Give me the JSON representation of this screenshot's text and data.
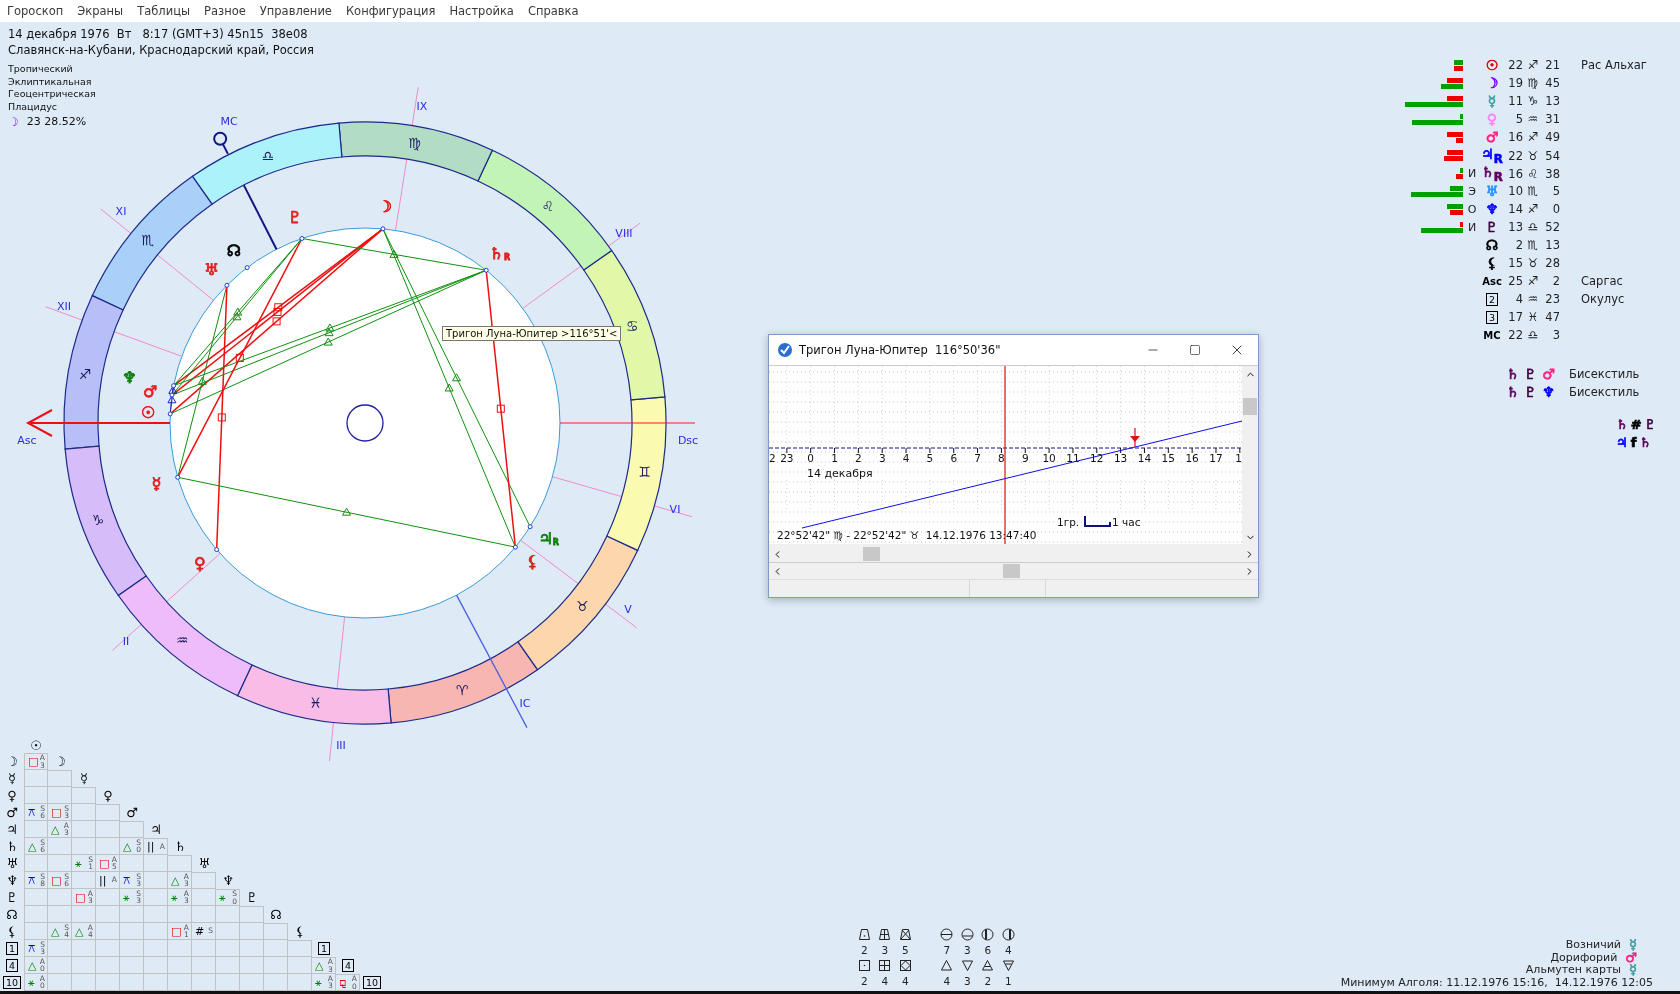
{
  "menu": [
    "Гороскоп",
    "Экраны",
    "Таблицы",
    "Разное",
    "Управление",
    "Конфигурация",
    "Настройка",
    "Справка"
  ],
  "header": {
    "date_line": "14 декабря 1976  Вт   8:17 (GMT+3) 45n15  38e08",
    "place": "Славянск-на-Кубани, Краснодарский край, Россия",
    "settings": [
      "Тропический",
      "Эклиптикальная",
      "Геоцентрическая",
      "Плацидус"
    ],
    "moon_glyph": "☽",
    "moon_phase": "23 28.52%"
  },
  "wheel": {
    "signs": [
      "♈",
      "♉",
      "♊",
      "♋",
      "♌",
      "♍",
      "♎",
      "♏",
      "♐",
      "♑",
      "♒",
      "♓"
    ],
    "houses": [
      "Asc",
      "II",
      "III",
      "IC",
      "V",
      "VI",
      "Dsc",
      "VIII",
      "IX",
      "MC",
      "XI",
      "XII"
    ],
    "planets": [
      {
        "glyph": "☉",
        "color": "#e02020"
      },
      {
        "glyph": "☽",
        "color": "#e02020"
      },
      {
        "glyph": "☿",
        "color": "#e02020"
      },
      {
        "glyph": "♀",
        "color": "#e02020"
      },
      {
        "glyph": "♂",
        "color": "#e02020"
      },
      {
        "glyph": "♃",
        "suffix": "R",
        "color": "#108010"
      },
      {
        "glyph": "♄",
        "suffix": "R",
        "color": "#e02020"
      },
      {
        "glyph": "♅",
        "color": "#e02020"
      },
      {
        "glyph": "♆",
        "color": "#108010"
      },
      {
        "glyph": "♇",
        "color": "#e02020"
      },
      {
        "glyph": "☊",
        "color": "#000000"
      },
      {
        "glyph": "⚸",
        "color": "#e02020"
      }
    ],
    "tooltip": "Тригон Луна-Юпитер >116°51'<"
  },
  "positions": [
    {
      "kind": "planet",
      "bars": [
        {
          "kind": "plus"
        },
        {
          "kind": "minus"
        }
      ],
      "glyph": "☉",
      "color": "#e00000",
      "degree": "22",
      "sign": "♐",
      "minute": "21",
      "star": "Рас Альхаг"
    },
    {
      "kind": "planet",
      "bars": [
        {
          "kind": "minus"
        },
        {
          "kind": "plus"
        }
      ],
      "glyph": "☽",
      "color": "#8000ff",
      "degree": "19",
      "sign": "♍",
      "minute": "45"
    },
    {
      "kind": "planet",
      "bars": [
        {
          "kind": "minus"
        },
        {
          "kind": "plus"
        }
      ],
      "glyph": "☿",
      "color": "#40a0a0",
      "degree": "11",
      "sign": "♑",
      "minute": "13"
    },
    {
      "kind": "planet",
      "bars": [
        {
          "kind": "plus"
        },
        {
          "kind": "plus"
        }
      ],
      "glyph": "♀",
      "color": "#ff80ff",
      "degree": "5",
      "sign": "♒",
      "minute": "31"
    },
    {
      "kind": "planet",
      "bars": [
        {
          "kind": "minus"
        },
        {
          "kind": "minus"
        }
      ],
      "glyph": "♂",
      "color": "#ff2080",
      "degree": "16",
      "sign": "♐",
      "minute": "49"
    },
    {
      "kind": "planet",
      "bars": [
        {
          "kind": "minus"
        },
        {
          "kind": "minus"
        }
      ],
      "glyph": "♃",
      "suffix": "R",
      "color": "#0000ff",
      "degree": "22",
      "sign": "♉",
      "minute": "54"
    },
    {
      "kind": "planet",
      "bars": [
        {
          "kind": "plus"
        },
        {
          "kind": "minus"
        }
      ],
      "marker": "И",
      "glyph": "♄",
      "suffix": "R",
      "color": "#600060",
      "degree": "16",
      "sign": "♌",
      "minute": "38"
    },
    {
      "kind": "planet",
      "bars": [
        {
          "kind": "plus"
        },
        {
          "kind": "plus"
        }
      ],
      "marker": "Э",
      "glyph": "♅",
      "color": "#2090ff",
      "degree": "10",
      "sign": "♏",
      "minute": "5"
    },
    {
      "kind": "planet",
      "bars": [
        {
          "kind": "plus"
        },
        {
          "kind": "minus"
        }
      ],
      "marker": "О",
      "glyph": "♆",
      "color": "#0000ff",
      "degree": "14",
      "sign": "♐",
      "minute": "0"
    },
    {
      "kind": "planet",
      "bars": [
        {
          "kind": "minus"
        },
        {
          "kind": "plus"
        }
      ],
      "marker": "И",
      "glyph": "♇",
      "color": "#400040",
      "degree": "13",
      "sign": "♎",
      "minute": "52"
    },
    {
      "kind": "planet",
      "glyph": "☊",
      "color": "#000000",
      "degree": "2",
      "sign": "♏",
      "minute": "13"
    },
    {
      "kind": "planet",
      "glyph": "⚸",
      "color": "#000000",
      "degree": "15",
      "sign": "♉",
      "minute": "28"
    },
    {
      "kind": "point",
      "glyph": "Asc",
      "color": "#000000",
      "degree": "25",
      "sign": "♐",
      "minute": "2",
      "star": "Саргас"
    },
    {
      "kind": "house",
      "glyph": "2",
      "color": "#000000",
      "degree": "4",
      "sign": "♒",
      "minute": "23",
      "star": "Окулус"
    },
    {
      "kind": "house",
      "glyph": "3",
      "color": "#000000",
      "degree": "17",
      "sign": "♓",
      "minute": "47"
    },
    {
      "kind": "point",
      "glyph": "MC",
      "color": "#000000",
      "degree": "22",
      "sign": "♎",
      "minute": "3"
    }
  ],
  "configurations": [
    {
      "glyphs": [
        {
          "text": "♄",
          "color": "#600060"
        },
        {
          "text": "♇",
          "color": "#400040"
        },
        {
          "text": "♂",
          "color": "#ff2080"
        }
      ],
      "label": "Бисекстиль"
    },
    {
      "glyphs": [
        {
          "text": "♄",
          "color": "#600060"
        },
        {
          "text": "♇",
          "color": "#400040"
        },
        {
          "text": "♆",
          "color": "#0000ff"
        }
      ],
      "label": "Бисекстиль"
    }
  ],
  "relations": [
    [
      {
        "text": "♄",
        "color": "#600060"
      },
      {
        "text": "#",
        "color": "#000000"
      },
      {
        "text": "♇",
        "color": "#400040"
      }
    ],
    [
      {
        "text": "♃",
        "color": "#0000ff"
      },
      {
        "text": "f",
        "color": "#000000"
      },
      {
        "text": "♄",
        "color": "#600060"
      }
    ]
  ],
  "aspect_grid": {
    "header": "☉",
    "rows": [
      {
        "kind": "planet",
        "label": "☽",
        "diagonal": "☽",
        "cells": [
          {
            "kind": "square",
            "symbol": "□",
            "mode": "A",
            "orb": "3"
          }
        ]
      },
      {
        "kind": "planet",
        "label": "☿",
        "diagonal": "☿",
        "cells": [
          {
            "kind": "none"
          },
          {
            "kind": "none"
          }
        ]
      },
      {
        "kind": "planet",
        "label": "♀",
        "diagonal": "♀",
        "cells": [
          {
            "kind": "none"
          },
          {
            "kind": "none"
          },
          {
            "kind": "none"
          }
        ]
      },
      {
        "kind": "planet",
        "label": "♂",
        "diagonal": "♂",
        "cells": [
          {
            "kind": "quincunx",
            "symbol": "⚻",
            "mode": "S",
            "orb": "6"
          },
          {
            "kind": "square",
            "symbol": "□",
            "mode": "S",
            "orb": "3"
          },
          {
            "kind": "none"
          },
          {
            "kind": "none"
          }
        ]
      },
      {
        "kind": "planet",
        "label": "♃",
        "diagonal": "♃",
        "cells": [
          {
            "kind": "none"
          },
          {
            "kind": "trine",
            "symbol": "△",
            "mode": "A",
            "orb": "3"
          },
          {
            "kind": "none"
          },
          {
            "kind": "none"
          },
          {
            "kind": "none"
          }
        ]
      },
      {
        "kind": "planet",
        "label": "♄",
        "diagonal": "♄",
        "cells": [
          {
            "kind": "trine",
            "symbol": "△",
            "mode": "S",
            "orb": "6"
          },
          {
            "kind": "none"
          },
          {
            "kind": "none"
          },
          {
            "kind": "none"
          },
          {
            "kind": "trine",
            "symbol": "△",
            "mode": "S",
            "orb": "0"
          },
          {
            "kind": "parallel",
            "symbol": "||",
            "mode": "A"
          }
        ]
      },
      {
        "kind": "planet",
        "label": "♅",
        "diagonal": "♅",
        "cells": [
          {
            "kind": "none"
          },
          {
            "kind": "none"
          },
          {
            "kind": "sextile",
            "symbol": "⚹",
            "mode": "S",
            "orb": "1"
          },
          {
            "kind": "square",
            "symbol": "□",
            "mode": "A",
            "orb": "5"
          },
          {
            "kind": "none"
          },
          {
            "kind": "none"
          },
          {
            "kind": "none"
          }
        ]
      },
      {
        "kind": "planet",
        "label": "♆",
        "diagonal": "♆",
        "cells": [
          {
            "kind": "quincunx",
            "symbol": "⚻",
            "mode": "S",
            "orb": "8"
          },
          {
            "kind": "square",
            "symbol": "□",
            "mode": "S",
            "orb": "6"
          },
          {
            "kind": "none"
          },
          {
            "kind": "parallel",
            "symbol": "||",
            "mode": "A"
          },
          {
            "kind": "quincunx",
            "symbol": "⚻",
            "mode": "S",
            "orb": "3"
          },
          {
            "kind": "none"
          },
          {
            "kind": "trine",
            "symbol": "△",
            "mode": "A",
            "orb": "3"
          },
          {
            "kind": "none"
          }
        ]
      },
      {
        "kind": "planet",
        "label": "♇",
        "diagonal": "♇",
        "cells": [
          {
            "kind": "none"
          },
          {
            "kind": "none"
          },
          {
            "kind": "square",
            "symbol": "□",
            "mode": "A",
            "orb": "3"
          },
          {
            "kind": "none"
          },
          {
            "kind": "sextile",
            "symbol": "⚹",
            "mode": "S",
            "orb": "3"
          },
          {
            "kind": "none"
          },
          {
            "kind": "sextile",
            "symbol": "⚹",
            "mode": "A",
            "orb": "3"
          },
          {
            "kind": "none"
          },
          {
            "kind": "sextile",
            "symbol": "⚹",
            "mode": "S",
            "orb": "0"
          }
        ]
      },
      {
        "kind": "planet",
        "label": "☊",
        "diagonal": "☊",
        "cells": [
          {
            "kind": "none"
          },
          {
            "kind": "none"
          },
          {
            "kind": "none"
          },
          {
            "kind": "none"
          },
          {
            "kind": "none"
          },
          {
            "kind": "none"
          },
          {
            "kind": "none"
          },
          {
            "kind": "none"
          },
          {
            "kind": "none"
          },
          {
            "kind": "none"
          }
        ]
      },
      {
        "kind": "planet",
        "label": "⚸",
        "diagonal": "⚸",
        "cells": [
          {
            "kind": "none"
          },
          {
            "kind": "trine",
            "symbol": "△",
            "mode": "S",
            "orb": "4"
          },
          {
            "kind": "trine",
            "symbol": "△",
            "mode": "A",
            "orb": "4"
          },
          {
            "kind": "none"
          },
          {
            "kind": "none"
          },
          {
            "kind": "none"
          },
          {
            "kind": "square",
            "symbol": "□",
            "mode": "A",
            "orb": "1"
          },
          {
            "kind": "contraparallel",
            "symbol": "#",
            "mode": "S"
          },
          {
            "kind": "none"
          },
          {
            "kind": "none"
          },
          {
            "kind": "none"
          }
        ]
      },
      {
        "kind": "house",
        "label": "1",
        "diagonal": "1",
        "cells": [
          {
            "kind": "quincunx",
            "symbol": "⚻",
            "mode": "S",
            "orb": "3"
          },
          {
            "kind": "none"
          },
          {
            "kind": "none"
          },
          {
            "kind": "none"
          },
          {
            "kind": "none"
          },
          {
            "kind": "none"
          },
          {
            "kind": "none"
          },
          {
            "kind": "none"
          },
          {
            "kind": "none"
          },
          {
            "kind": "none"
          },
          {
            "kind": "none"
          },
          {
            "kind": "none"
          }
        ]
      },
      {
        "kind": "house",
        "label": "4",
        "diagonal": "4",
        "cells": [
          {
            "kind": "trine",
            "symbol": "△",
            "mode": "A",
            "orb": "0"
          },
          {
            "kind": "none"
          },
          {
            "kind": "none"
          },
          {
            "kind": "none"
          },
          {
            "kind": "none"
          },
          {
            "kind": "none"
          },
          {
            "kind": "none"
          },
          {
            "kind": "none"
          },
          {
            "kind": "none"
          },
          {
            "kind": "none"
          },
          {
            "kind": "none"
          },
          {
            "kind": "none"
          },
          {
            "kind": "trine",
            "symbol": "△",
            "mode": "A",
            "orb": "3"
          }
        ]
      },
      {
        "kind": "house",
        "label": "10",
        "diagonal": "10",
        "cells": [
          {
            "kind": "sextile",
            "symbol": "⚹",
            "mode": "A",
            "orb": "0"
          },
          {
            "kind": "none"
          },
          {
            "kind": "none"
          },
          {
            "kind": "none"
          },
          {
            "kind": "none"
          },
          {
            "kind": "none"
          },
          {
            "kind": "none"
          },
          {
            "kind": "none"
          },
          {
            "kind": "none"
          },
          {
            "kind": "none"
          },
          {
            "kind": "none"
          },
          {
            "kind": "none"
          },
          {
            "kind": "sextile",
            "symbol": "⚹",
            "mode": "A",
            "orb": "3"
          },
          {
            "kind": "sesquiquadrate",
            "symbol": "⚼",
            "mode": "A",
            "orb": "0"
          }
        ]
      }
    ]
  },
  "counters": [
    [
      {
        "kind": "trapezoid-dot",
        "value": "2"
      },
      {
        "kind": "trapezoid-grid",
        "value": "3"
      },
      {
        "kind": "trapezoid-cross",
        "value": "5"
      },
      {
        "kind": "circle-bar",
        "value": "7"
      },
      {
        "kind": "circle-low",
        "value": "3"
      },
      {
        "kind": "circle-left",
        "value": "6"
      },
      {
        "kind": "circle-right",
        "value": "4"
      }
    ],
    [
      {
        "kind": "square-dot",
        "value": "2"
      },
      {
        "kind": "square-grid",
        "value": "4"
      },
      {
        "kind": "square-diamond",
        "value": "4"
      },
      {
        "kind": "triangle-up",
        "value": "4"
      },
      {
        "kind": "triangle-down",
        "value": "3"
      },
      {
        "kind": "triangle-up-bar",
        "value": "2"
      },
      {
        "kind": "triangle-down-bar",
        "value": "1"
      }
    ]
  ],
  "rulers": [
    {
      "label": "Возничий",
      "glyph": "☿",
      "color": "#40a0a0"
    },
    {
      "label": "Дорифорий",
      "glyph": "♂",
      "color": "#ff2080"
    },
    {
      "label": "Альмутен карты",
      "glyph": "☿",
      "color": "#40a0a0"
    }
  ],
  "algol": "Минимум Алголя: 11.12.1976 15:16,  14.12.1976 12:05",
  "popup": {
    "title": "Тригон Луна-Юпитер  116°50'36\"",
    "hours": [
      "2",
      "23",
      "0",
      "1",
      "2",
      "3",
      "4",
      "5",
      "6",
      "7",
      "8",
      "9",
      "10",
      "11",
      "12",
      "13",
      "14",
      "15",
      "16",
      "17",
      "1"
    ],
    "date": "14 декабря",
    "scale": "1гр.",
    "unit": "1 час",
    "reading": "22°52'42\" ♍ - 22°52'42\" ♉  14.12.1976 13:47:40"
  }
}
